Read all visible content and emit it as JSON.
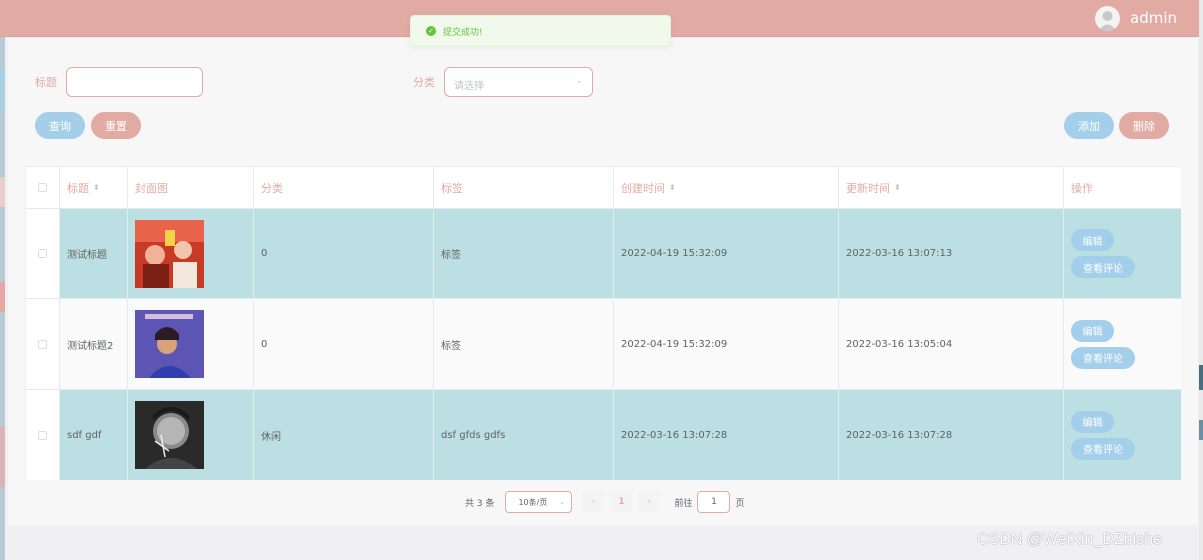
{
  "header": {
    "username": "admin",
    "avatar_icon": "user-avatar-icon"
  },
  "toast": {
    "message": "提交成功!",
    "type": "success"
  },
  "search": {
    "title_label": "标题",
    "title_value": "",
    "category_label": "分类",
    "category_placeholder": "请选择",
    "query_label": "查询",
    "reset_label": "重置"
  },
  "toolbar": {
    "add_label": "添加",
    "delete_label": "删除"
  },
  "table": {
    "columns": [
      "标题",
      "封面图",
      "分类",
      "标签",
      "创建时间",
      "更新时间",
      "操作"
    ],
    "rows": [
      {
        "title": "测试标题",
        "category": "0",
        "tags": "标签",
        "created": "2022-04-19 15:32:09",
        "updated": "2022-03-16 13:07:13",
        "edit": "编辑",
        "comments": "查看评论"
      },
      {
        "title": "测试标题2",
        "category": "0",
        "tags": "标签",
        "created": "2022-04-19 15:32:09",
        "updated": "2022-03-16 13:05:04",
        "edit": "编辑",
        "comments": "查看评论"
      },
      {
        "title": "sdf gdf",
        "category": "休闲",
        "tags": "dsf gfds gdfs",
        "created": "2022-03-16 13:07:28",
        "updated": "2022-03-16 13:07:28",
        "edit": "编辑",
        "comments": "查看评论"
      }
    ]
  },
  "pagination": {
    "total_text": "共 3 条",
    "page_size": "10条/页",
    "prev_icon": "‹",
    "current_page": "1",
    "next_icon": "›",
    "goto_label": "前往",
    "goto_value": "1",
    "page_suffix": "页"
  },
  "watermark": "CSDN @WeiXin_DZbishe",
  "colors": {
    "accent_pink": "#e1aba4",
    "accent_blue": "#a4cfea",
    "row_teal": "#bcdfe3",
    "success": "#67c23a"
  }
}
